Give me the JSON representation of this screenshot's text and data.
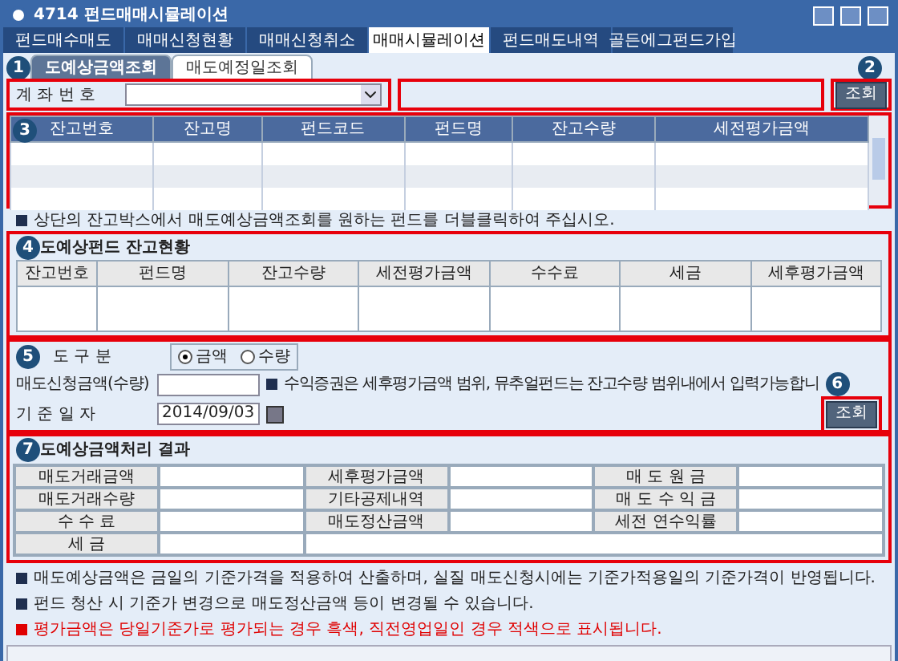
{
  "window": {
    "title": "4714 펀드매매시뮬레이션"
  },
  "tabs": [
    {
      "label": "펀드매수매도",
      "selected": false
    },
    {
      "label": "매매신청현황",
      "selected": false
    },
    {
      "label": "매매신청취소",
      "selected": false
    },
    {
      "label": "매매시뮬레이션",
      "selected": true
    },
    {
      "label": "펀드매도내역",
      "selected": false
    },
    {
      "label": "골든에그펀드가입",
      "selected": false
    }
  ],
  "subtabs": [
    {
      "label": "도예상금액조회",
      "selected": true
    },
    {
      "label": "매도예정일조회",
      "selected": false
    }
  ],
  "badges": [
    "1",
    "2",
    "3",
    "4",
    "5",
    "6",
    "7"
  ],
  "account": {
    "label": "계 좌 번 호",
    "button": "조회"
  },
  "balance_table": {
    "columns": [
      "잔고번호",
      "잔고명",
      "펀드코드",
      "펀드명",
      "잔고수량",
      "세전평가금액"
    ]
  },
  "note1": "상단의 잔고박스에서 매도예상금액조회를 원하는 펀드를 더블클릭하여 주십시오.",
  "fund_section": {
    "title": "도예상펀드 잔고현황",
    "columns": [
      "잔고번호",
      "펀드명",
      "잔고수량",
      "세전평가금액",
      "수수료",
      "세금",
      "세후평가금액"
    ]
  },
  "order": {
    "type_label": "도 구 분",
    "options": [
      {
        "label": "금액",
        "selected": true
      },
      {
        "label": "수량",
        "selected": false
      }
    ],
    "amount_label": "매도신청금액(수량)",
    "note": "수익증권은 세후평가금액 범위, 뮤추얼펀드는 잔고수량 범위내에서 입력가능합니",
    "date_label": "기 준 일 자",
    "date": "2014/09/03",
    "button": "조회"
  },
  "result": {
    "title": "도예상금액처리 결과",
    "rows": [
      [
        "매도거래금액",
        "세후평가금액",
        "매 도 원 금"
      ],
      [
        "매도거래수량",
        "기타공제내역",
        "매 도 수 익 금"
      ],
      [
        "수 수 료",
        "매도정산금액",
        "세전 연수익률"
      ],
      [
        "세 금"
      ]
    ]
  },
  "notes": [
    {
      "text": "매도예상금액은 금일의 기준가격을 적용하여 산출하며, 실질 매도신청시에는 기준가적용일의 기준가격이 반영됩니다.",
      "kind": "normal"
    },
    {
      "text": "펀드 청산 시 기준가 변경으로 매도정산금액 등이 변경될 수 있습니다.",
      "kind": "normal"
    },
    {
      "text": "평가금액은 당일기준가로 평가되는 경우 흑색, 직전영업일인 경우 적색으로 표시됩니다.",
      "kind": "warning"
    }
  ]
}
